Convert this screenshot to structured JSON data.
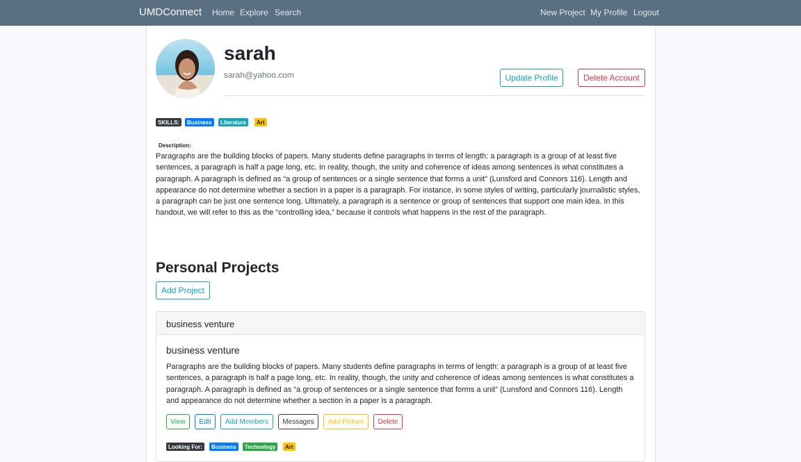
{
  "nav": {
    "brand": "UMDConnect",
    "left_links": [
      "Home",
      "Explore",
      "Search"
    ],
    "right_links": [
      "New Project",
      "My Profile",
      "Logout"
    ]
  },
  "profile": {
    "name": "sarah",
    "email": "sarah@yahoo.com",
    "update_button": "Update Profile",
    "delete_button": "Delete Account",
    "skills_label": "SKILLS:",
    "skills": [
      "Business",
      "Literature",
      "Art"
    ],
    "description_label": "Description:",
    "description": "Paragraphs are the building blocks of papers. Many students define paragraphs in terms of length: a paragraph is a group of at least five sentences, a paragraph is half a page long, etc. In reality, though, the unity and coherence of ideas among sentences is what constitutes a paragraph. A paragraph is defined as “a group of sentences or a single sentence that forms a unit” (Lunsford and Connors 116). Length and appearance do not determine whether a section in a paper is a paragraph. For instance, in some styles of writing, particularly journalistic styles, a paragraph can be just one sentence long. Ultimately, a paragraph is a sentence or group of sentences that support one main idea. In this handout, we will refer to this as the “controlling idea,” because it controls what happens in the rest of the paragraph."
  },
  "projects": {
    "title": "Personal Projects",
    "add_button": "Add Project",
    "items": [
      {
        "header": "business venture",
        "title": "business venture",
        "text": "Paragraphs are the building blocks of papers. Many students define paragraphs in terms of length: a paragraph is a group of at least five sentences, a paragraph is half a page long, etc. In reality, though, the unity and coherence of ideas among sentences is what constitutes a paragraph. A paragraph is defined as “a group of sentences or a single sentence that forms a unit” (Lunsford and Connors 116). Length and appearance do not determine whether a section in a paper is a paragraph.",
        "buttons": [
          "View",
          "Edit",
          "Add Members",
          "Messages",
          "Add Picture",
          "Delete"
        ],
        "looking_for_label": "Looking For:",
        "looking_for": [
          "Business",
          "Technology",
          "Art"
        ]
      }
    ]
  },
  "colors": {
    "navbar": "#5a6f82",
    "info": "#17a2b8",
    "danger": "#dc3545",
    "primary": "#007bff",
    "success": "#28a745",
    "warning": "#ffc107",
    "dark": "#343a40"
  }
}
